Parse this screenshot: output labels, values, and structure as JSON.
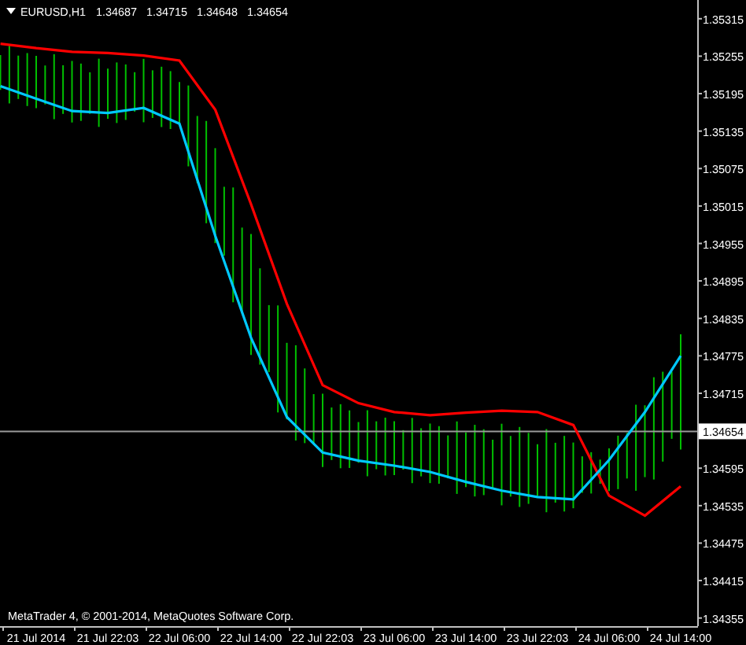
{
  "header": {
    "symbol": "EURUSD,H1",
    "quotes": [
      "1.34687",
      "1.34715",
      "1.34648",
      "1.34654"
    ]
  },
  "chart": {
    "chart_data": {
      "type": "line",
      "categories": [
        null,
        "21 Jul 2014",
        null,
        "21 Jul 22:03",
        null,
        "22 Jul 06:00",
        null,
        "22 Jul 14:00",
        null,
        "22 Jul 22:03",
        null,
        "23 Jul 06:00",
        null,
        "23 Jul 14:00",
        null,
        "23 Jul 22:03",
        null,
        "24 Jul 06:00",
        null,
        "24 Jul 14:00"
      ],
      "ylim": [
        1.34342,
        1.35345
      ],
      "yticks": [
        {
          "value": 1.35315,
          "label": "1.35315"
        },
        {
          "value": 1.35255,
          "label": "1.35255"
        },
        {
          "value": 1.35195,
          "label": "1.35195"
        },
        {
          "value": 1.35135,
          "label": "1.35135"
        },
        {
          "value": 1.35075,
          "label": "1.35075"
        },
        {
          "value": 1.35015,
          "label": "1.35015"
        },
        {
          "value": 1.34955,
          "label": "1.34955"
        },
        {
          "value": 1.34895,
          "label": "1.34895"
        },
        {
          "value": 1.34835,
          "label": "1.34835"
        },
        {
          "value": 1.34775,
          "label": "1.34775"
        },
        {
          "value": 1.34715,
          "label": "1.34715"
        },
        {
          "value": 1.34595,
          "label": "1.34595"
        },
        {
          "value": 1.34535,
          "label": "1.34535"
        },
        {
          "value": 1.34475,
          "label": "1.34475"
        },
        {
          "value": 1.34415,
          "label": "1.34415"
        },
        {
          "value": 1.34355,
          "label": "1.34355"
        }
      ],
      "series": [
        {
          "color": "#ff0000",
          "values": [
            1.35275,
            1.35268,
            1.35262,
            1.3526,
            1.35256,
            1.35248,
            1.35169,
            1.35018,
            1.34858,
            1.34728,
            1.34699,
            1.34685,
            1.3468,
            1.34684,
            1.34687,
            1.34685,
            1.34664,
            1.34551,
            1.34519,
            1.34566
          ]
        },
        {
          "color": "#00c8ff",
          "values": [
            1.35207,
            1.35187,
            1.35167,
            1.35164,
            1.35172,
            1.35147,
            1.34967,
            1.34804,
            1.34677,
            1.3462,
            1.34607,
            1.34599,
            1.34589,
            1.34573,
            1.34559,
            1.34549,
            1.34545,
            1.34608,
            1.34685,
            1.34775
          ]
        }
      ],
      "ref_lines": [
        {
          "axis": "y",
          "value": 1.34654,
          "label": "1.34654"
        }
      ]
    }
  },
  "footer": "MetaTrader 4, © 2001-2014, MetaQuotes Software Corp."
}
